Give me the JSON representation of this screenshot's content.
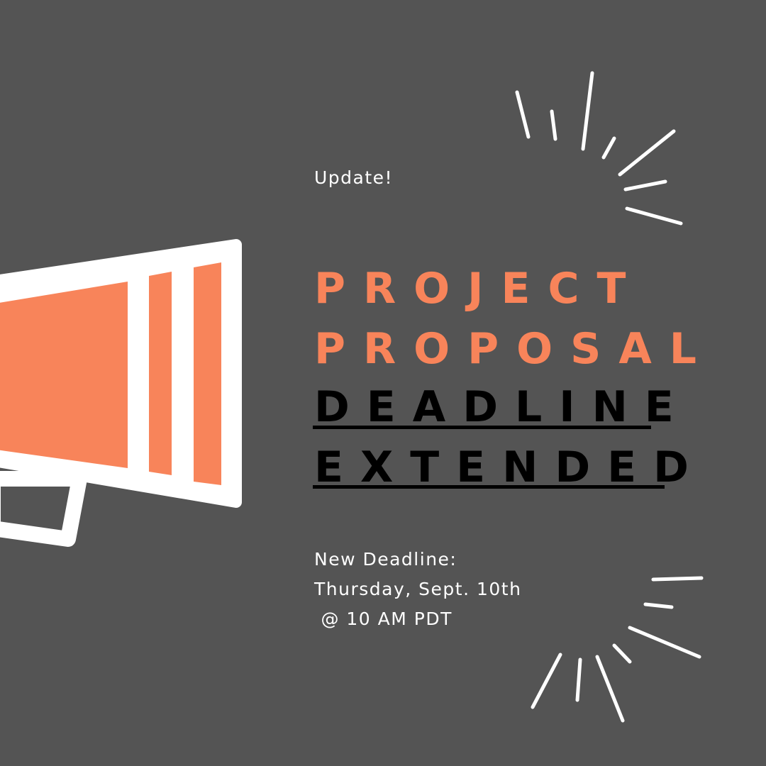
{
  "colors": {
    "background": "#545454",
    "accent": "#f8845a",
    "text_light": "#ffffff",
    "text_dark": "#000000"
  },
  "icons": [
    "megaphone-icon",
    "sparkle-burst-icon"
  ],
  "kicker": "Update!",
  "title": {
    "line1": "PROJECT",
    "line2": "PROPOSAL"
  },
  "headline": {
    "line1": "DEADLINE",
    "line2": "EXTENDED"
  },
  "details": {
    "label": "New Deadline:",
    "date": "Thursday, Sept. 10th",
    "time": " @ 10 AM PDT"
  }
}
